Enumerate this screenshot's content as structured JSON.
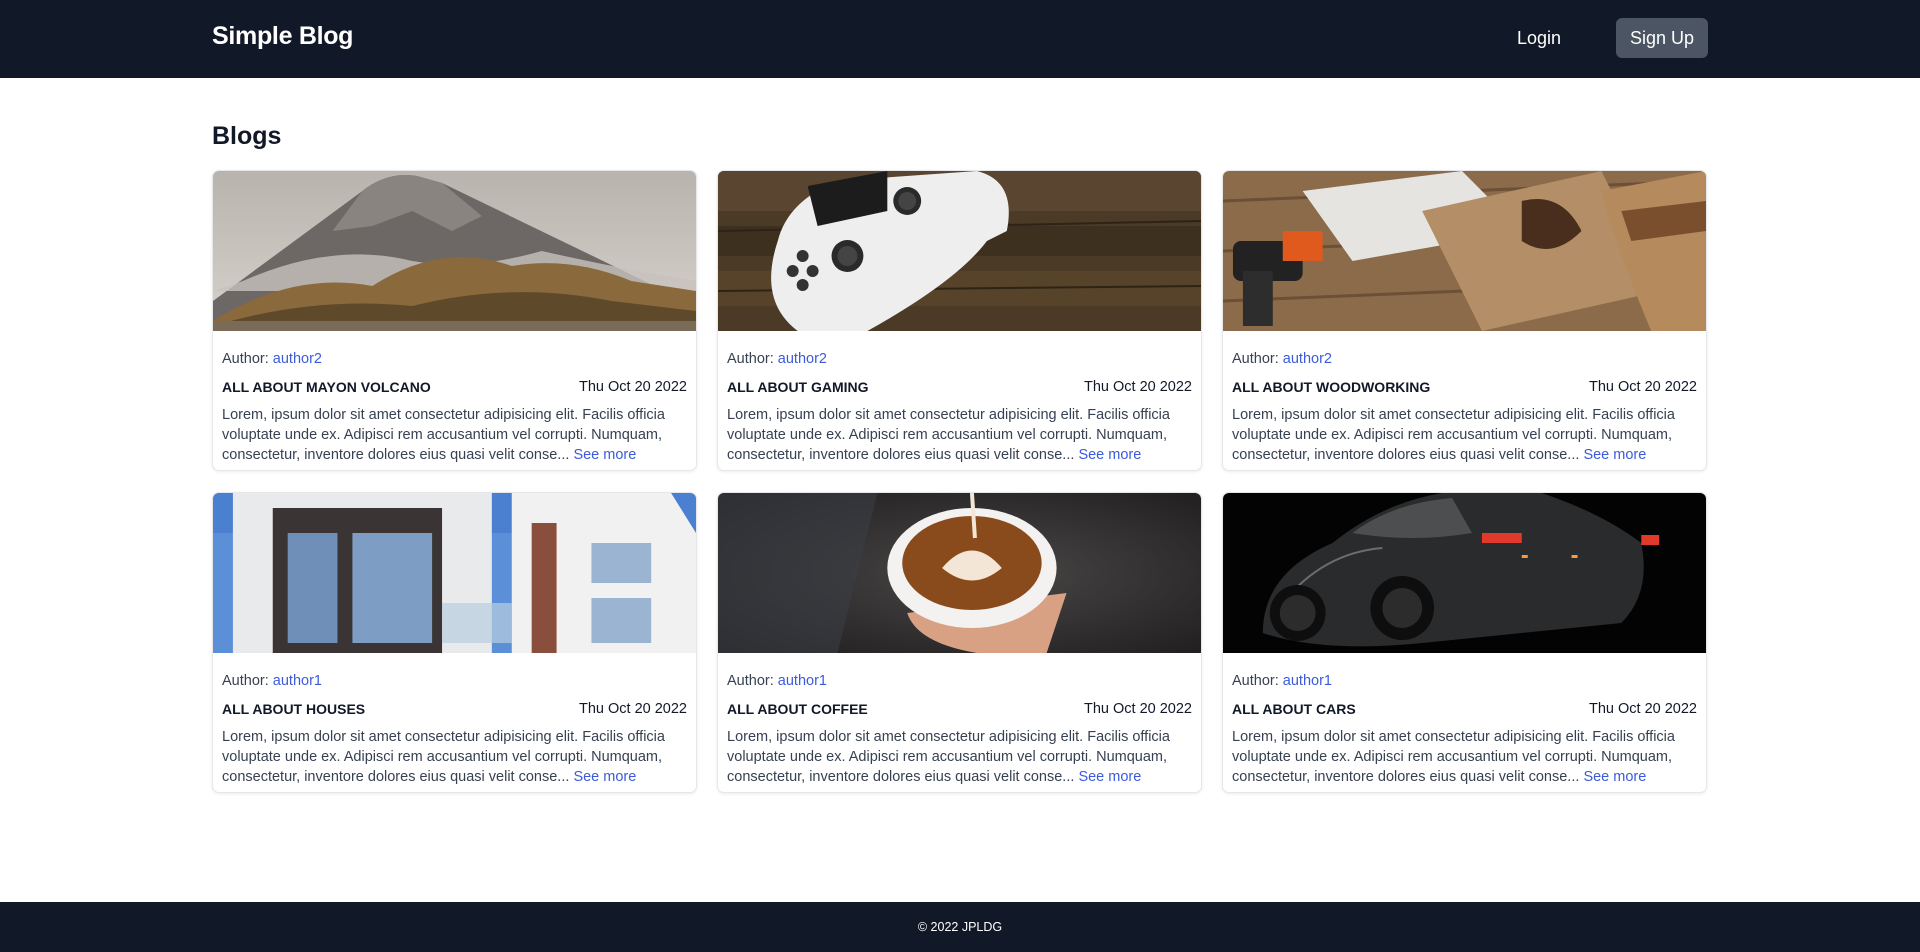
{
  "header": {
    "brand": "Simple Blog",
    "login_label": "Login",
    "signup_label": "Sign Up"
  },
  "main": {
    "section_title": "Blogs",
    "author_prefix": "Author:",
    "see_more_label": "See more",
    "posts": [
      {
        "image": "mayon-volcano-photo",
        "author": "author2",
        "title": "ALL ABOUT MAYON VOLCANO",
        "date": "Thu Oct 20 2022",
        "excerpt": "Lorem, ipsum dolor sit amet consectetur adipisicing elit. Facilis officia voluptate unde ex. Adipisci rem accusantium vel corrupti. Numquam, consectetur, inventore dolores eius quasi velit conse..."
      },
      {
        "image": "game-controller-photo",
        "author": "author2",
        "title": "ALL ABOUT GAMING",
        "date": "Thu Oct 20 2022",
        "excerpt": "Lorem, ipsum dolor sit amet consectetur adipisicing elit. Facilis officia voluptate unde ex. Adipisci rem accusantium vel corrupti. Numquam, consectetur, inventore dolores eius quasi velit conse..."
      },
      {
        "image": "woodworking-photo",
        "author": "author2",
        "title": "ALL ABOUT WOODWORKING",
        "date": "Thu Oct 20 2022",
        "excerpt": "Lorem, ipsum dolor sit amet consectetur adipisicing elit. Facilis officia voluptate unde ex. Adipisci rem accusantium vel corrupti. Numquam, consectetur, inventore dolores eius quasi velit conse..."
      },
      {
        "image": "modern-house-photo",
        "author": "author1",
        "title": "ALL ABOUT HOUSES",
        "date": "Thu Oct 20 2022",
        "excerpt": "Lorem, ipsum dolor sit amet consectetur adipisicing elit. Facilis officia voluptate unde ex. Adipisci rem accusantium vel corrupti. Numquam, consectetur, inventore dolores eius quasi velit conse..."
      },
      {
        "image": "latte-coffee-photo",
        "author": "author1",
        "title": "ALL ABOUT COFFEE",
        "date": "Thu Oct 20 2022",
        "excerpt": "Lorem, ipsum dolor sit amet consectetur adipisicing elit. Facilis officia voluptate unde ex. Adipisci rem accusantium vel corrupti. Numquam, consectetur, inventore dolores eius quasi velit conse..."
      },
      {
        "image": "dark-sports-car-photo",
        "author": "author1",
        "title": "ALL ABOUT CARS",
        "date": "Thu Oct 20 2022",
        "excerpt": "Lorem, ipsum dolor sit amet consectetur adipisicing elit. Facilis officia voluptate unde ex. Adipisci rem accusantium vel corrupti. Numquam, consectetur, inventore dolores eius quasi velit conse..."
      }
    ]
  },
  "footer": {
    "copyright": "© 2022 JPLDG"
  },
  "colors": {
    "navbar_bg": "#111827",
    "signup_bg": "#4b5563",
    "link": "#3b5bdb"
  }
}
